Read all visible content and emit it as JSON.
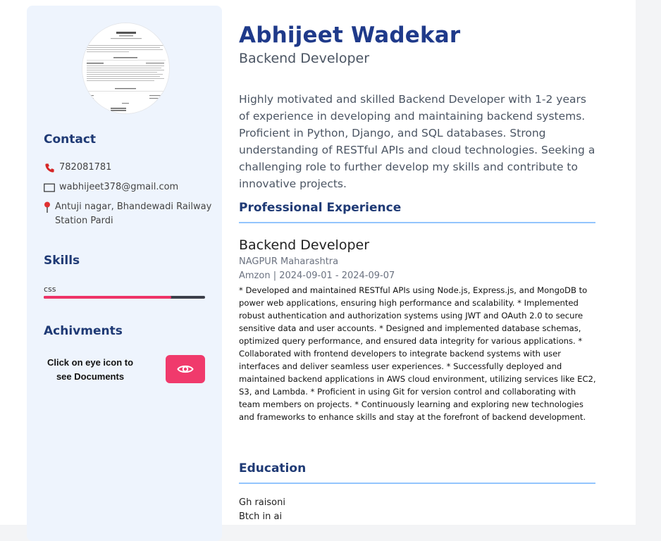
{
  "profile": {
    "name": "Abhijeet Wadekar",
    "role": "Backend Developer",
    "summary": "Highly motivated and skilled Backend Developer with 1-2 years of experience in developing and maintaining backend systems. Proficient in Python, Django, and SQL databases. Strong understanding of RESTful APIs and cloud technologies. Seeking a challenging role to further develop my skills and contribute to innovative projects."
  },
  "contact": {
    "heading": "Contact",
    "phone": "782081781",
    "email": "wabhijeet378@gmail.com",
    "address": "Antuji nagar, Bhandewadi Railway Station Pardi"
  },
  "skills": {
    "heading": "Skills",
    "items": [
      {
        "name": "css",
        "level": 0.79
      }
    ]
  },
  "achievements": {
    "heading": "Achivments",
    "note": "Click on eye icon to see Documents",
    "button_icon": "eye-icon"
  },
  "experience": {
    "heading": "Professional Experience",
    "jobs": [
      {
        "title": "Backend Developer",
        "location": "NAGPUR Maharashtra",
        "meta": "Amzon | 2024-09-01 - 2024-09-07",
        "description": "* Developed and maintained RESTful APIs using Node.js, Express.js, and MongoDB to power web applications, ensuring high performance and scalability. * Implemented robust authentication and authorization systems using JWT and OAuth 2.0 to secure sensitive data and user accounts. * Designed and implemented database schemas, optimized query performance, and ensured data integrity for various applications. * Collaborated with frontend developers to integrate backend systems with user interfaces and deliver seamless user experiences. * Successfully deployed and maintained backend applications in AWS cloud environment, utilizing services like EC2, S3, and Lambda. * Proficient in using Git for version control and collaborating with team members on projects. * Continuously learning and exploring new technologies and frameworks to enhance skills and stay at the forefront of backend development."
      }
    ]
  },
  "education": {
    "heading": "Education",
    "institution": "Gh raisoni",
    "degree": "Btch in ai"
  },
  "colors": {
    "accent": "#1f3a8a",
    "pink": "#f03a6c",
    "sidebar_bg": "#eef4fd",
    "rule": "#93c5fd"
  }
}
